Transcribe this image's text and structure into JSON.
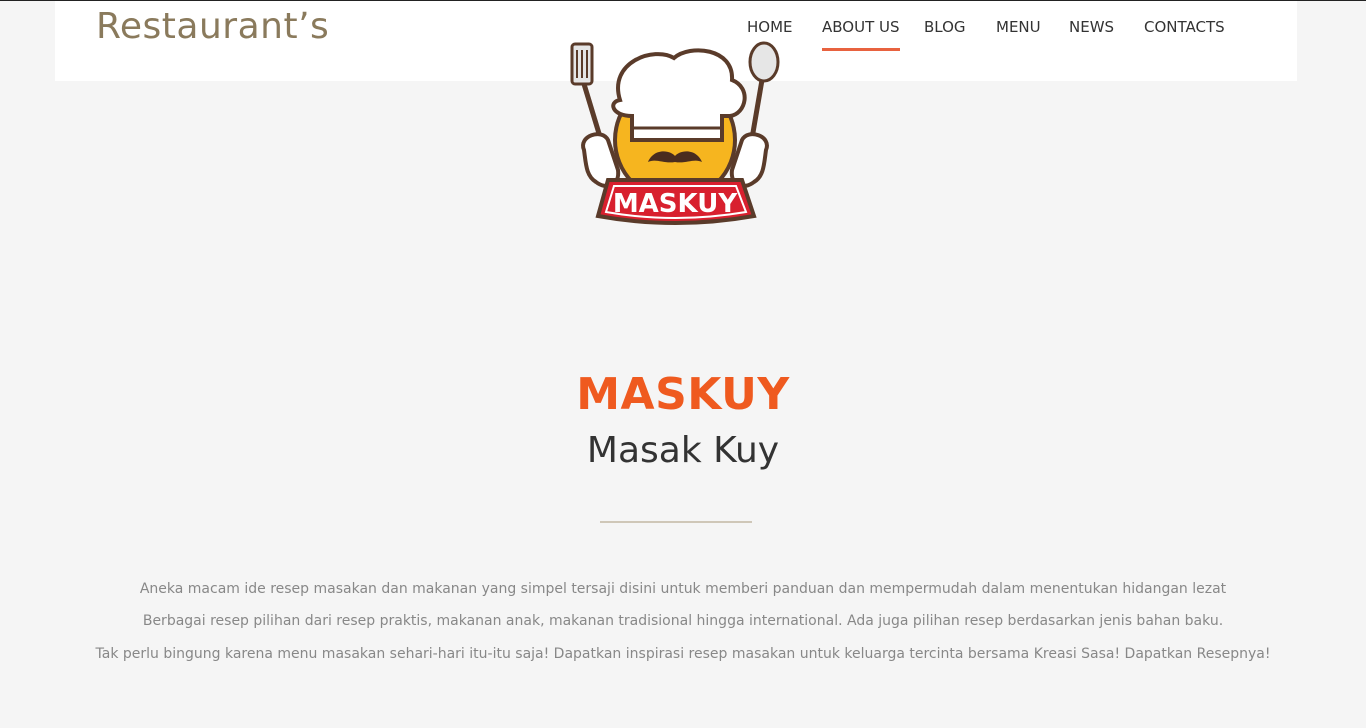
{
  "header": {
    "brand": "Restaurant’s",
    "nav": [
      {
        "label": "HOME",
        "active": false
      },
      {
        "label": "ABOUT US",
        "active": true
      },
      {
        "label": "BLOG",
        "active": false
      },
      {
        "label": "MENU",
        "active": false
      },
      {
        "label": "NEWS",
        "active": false
      },
      {
        "label": "CONTACTS",
        "active": false
      }
    ]
  },
  "logo": {
    "text": "MASKUY",
    "icon": "chef-mascot-logo"
  },
  "hero": {
    "title": "MASKUY",
    "subtitle": "Masak Kuy"
  },
  "description": [
    "Aneka macam ide resep masakan dan makanan yang simpel tersaji disini untuk memberi panduan dan mempermudah dalam menentukan hidangan lezat",
    "Berbagai resep pilihan dari resep praktis, makanan anak, makanan tradisional hingga international. Ada juga pilihan resep berdasarkan jenis bahan baku.",
    "Tak perlu bingung karena menu masakan sehari-hari itu-itu saja! Dapatkan inspirasi resep masakan untuk keluarga tercinta bersama Kreasi Sasa! Dapatkan Resepnya!"
  ],
  "colors": {
    "accent": "#e8623f",
    "title": "#ef5a1f",
    "brand": "#8a7a5c",
    "background": "#f5f5f5"
  }
}
